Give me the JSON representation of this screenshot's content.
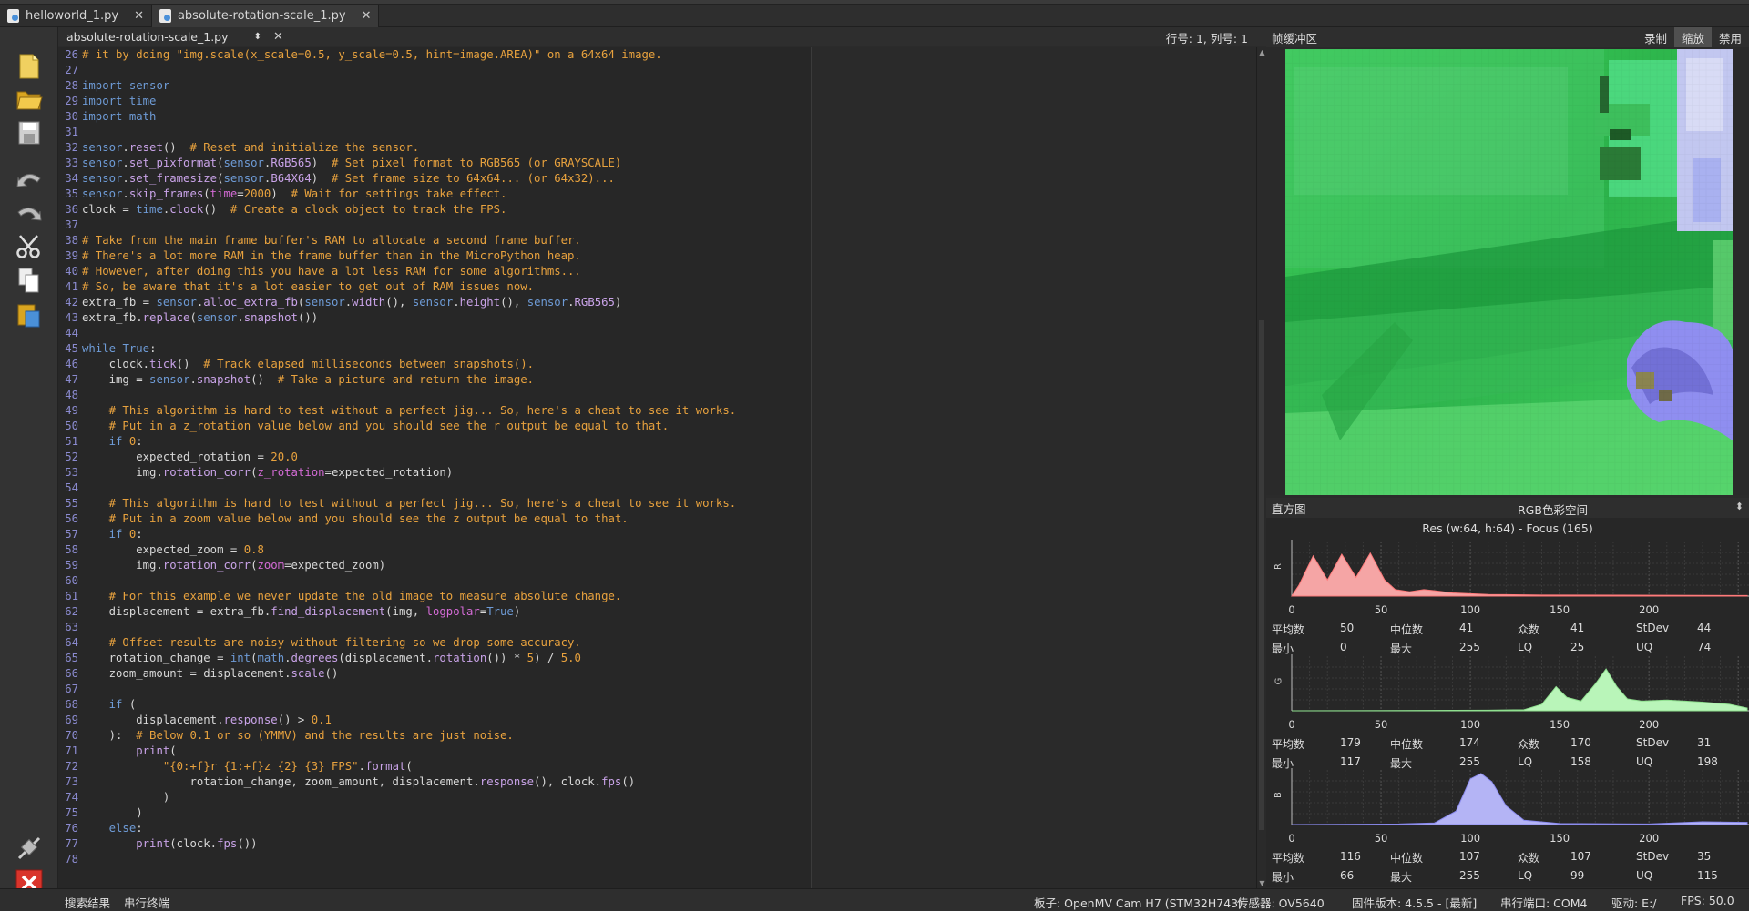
{
  "tabs": [
    {
      "label": "helloworld_1.py",
      "active": false
    },
    {
      "label": "absolute-rotation-scale_1.py",
      "active": true
    }
  ],
  "editor": {
    "file_selector": "absolute-rotation-scale_1.py",
    "cursor_pos": "行号: 1, 列号: 1",
    "lines": [
      {
        "n": "26",
        "h": [
          [
            "c-cm",
            "# it by doing \"img.scale(x_scale=0.5, y_scale=0.5, hint=image.AREA)\" on a 64x64 image."
          ]
        ]
      },
      {
        "n": "27",
        "h": []
      },
      {
        "n": "28",
        "h": [
          [
            "c-kw",
            "import"
          ],
          [
            "",
            "",
            " "
          ],
          [
            "c-mod",
            "sensor"
          ]
        ]
      },
      {
        "n": "29",
        "h": [
          [
            "c-kw",
            "import"
          ],
          [
            "",
            " "
          ],
          [
            "c-mod",
            "time"
          ]
        ]
      },
      {
        "n": "30",
        "h": [
          [
            "c-kw",
            "import"
          ],
          [
            "",
            " "
          ],
          [
            "c-mod",
            "math"
          ]
        ]
      },
      {
        "n": "31",
        "h": []
      },
      {
        "n": "32",
        "h": [
          [
            "c-mod",
            "sensor"
          ],
          [
            "",
            "."
          ],
          [
            "c-fn",
            "reset"
          ],
          [
            "",
            "()  "
          ],
          [
            "c-cm",
            "# Reset and initialize the sensor."
          ]
        ]
      },
      {
        "n": "33",
        "h": [
          [
            "c-mod",
            "sensor"
          ],
          [
            "",
            "."
          ],
          [
            "c-fn",
            "set_pixformat"
          ],
          [
            "",
            "("
          ],
          [
            "c-mod",
            "sensor"
          ],
          [
            "",
            "."
          ],
          [
            "c-fn",
            "RGB565"
          ],
          [
            "",
            ")  "
          ],
          [
            "c-cm",
            "# Set pixel format to RGB565 (or GRAYSCALE)"
          ]
        ]
      },
      {
        "n": "34",
        "h": [
          [
            "c-mod",
            "sensor"
          ],
          [
            "",
            "."
          ],
          [
            "c-fn",
            "set_framesize"
          ],
          [
            "",
            "("
          ],
          [
            "c-mod",
            "sensor"
          ],
          [
            "",
            "."
          ],
          [
            "c-fn",
            "B64X64"
          ],
          [
            "",
            ")  "
          ],
          [
            "c-cm",
            "# Set frame size to 64x64... (or 64x32)..."
          ]
        ]
      },
      {
        "n": "35",
        "h": [
          [
            "c-mod",
            "sensor"
          ],
          [
            "",
            "."
          ],
          [
            "c-fn",
            "skip_frames"
          ],
          [
            "",
            "("
          ],
          [
            "c-kwa",
            "time"
          ],
          [
            "",
            "="
          ],
          [
            "c-num",
            "2000"
          ],
          [
            "",
            ")  "
          ],
          [
            "c-cm",
            "# Wait for settings take effect."
          ]
        ]
      },
      {
        "n": "36",
        "h": [
          [
            "",
            "clock = "
          ],
          [
            "c-mod",
            "time"
          ],
          [
            "",
            "."
          ],
          [
            "c-fn",
            "clock"
          ],
          [
            "",
            "()  "
          ],
          [
            "c-cm",
            "# Create a clock object to track the FPS."
          ]
        ]
      },
      {
        "n": "37",
        "h": []
      },
      {
        "n": "38",
        "h": [
          [
            "c-cm",
            "# Take from the main frame buffer's RAM to allocate a second frame buffer."
          ]
        ]
      },
      {
        "n": "39",
        "h": [
          [
            "c-cm",
            "# There's a lot more RAM in the frame buffer than in the MicroPython heap."
          ]
        ]
      },
      {
        "n": "40",
        "h": [
          [
            "c-cm",
            "# However, after doing this you have a lot less RAM for some algorithms..."
          ]
        ]
      },
      {
        "n": "41",
        "h": [
          [
            "c-cm",
            "# So, be aware that it's a lot easier to get out of RAM issues now."
          ]
        ]
      },
      {
        "n": "42",
        "h": [
          [
            "",
            "extra_fb = "
          ],
          [
            "c-mod",
            "sensor"
          ],
          [
            "",
            "."
          ],
          [
            "c-fn",
            "alloc_extra_fb"
          ],
          [
            "",
            "("
          ],
          [
            "c-mod",
            "sensor"
          ],
          [
            "",
            "."
          ],
          [
            "c-fn",
            "width"
          ],
          [
            "",
            "(), "
          ],
          [
            "c-mod",
            "sensor"
          ],
          [
            "",
            "."
          ],
          [
            "c-fn",
            "height"
          ],
          [
            "",
            "(), "
          ],
          [
            "c-mod",
            "sensor"
          ],
          [
            "",
            "."
          ],
          [
            "c-fn",
            "RGB565"
          ],
          [
            "",
            ")"
          ]
        ]
      },
      {
        "n": "43",
        "h": [
          [
            "",
            "extra_fb."
          ],
          [
            "c-fn",
            "replace"
          ],
          [
            "",
            "("
          ],
          [
            "c-mod",
            "sensor"
          ],
          [
            "",
            "."
          ],
          [
            "c-fn",
            "snapshot"
          ],
          [
            "",
            "())"
          ]
        ]
      },
      {
        "n": "44",
        "h": []
      },
      {
        "n": "45",
        "h": [
          [
            "c-kw",
            "while"
          ],
          [
            "",
            " "
          ],
          [
            "c-kw",
            "True"
          ],
          [
            "",
            ":"
          ]
        ]
      },
      {
        "n": "46",
        "h": [
          [
            "",
            "    clock."
          ],
          [
            "c-fn",
            "tick"
          ],
          [
            "",
            "()  "
          ],
          [
            "c-cm",
            "# Track elapsed milliseconds between snapshots()."
          ]
        ]
      },
      {
        "n": "47",
        "h": [
          [
            "",
            "    img = "
          ],
          [
            "c-mod",
            "sensor"
          ],
          [
            "",
            "."
          ],
          [
            "c-fn",
            "snapshot"
          ],
          [
            "",
            "()  "
          ],
          [
            "c-cm",
            "# Take a picture and return the image."
          ]
        ]
      },
      {
        "n": "48",
        "h": []
      },
      {
        "n": "49",
        "h": [
          [
            "",
            "    "
          ],
          [
            "c-cm",
            "# This algorithm is hard to test without a perfect jig... So, here's a cheat to see it works."
          ]
        ]
      },
      {
        "n": "50",
        "h": [
          [
            "",
            "    "
          ],
          [
            "c-cm",
            "# Put in a z_rotation value below and you should see the r output be equal to that."
          ]
        ]
      },
      {
        "n": "51",
        "h": [
          [
            "",
            "    "
          ],
          [
            "c-kw",
            "if"
          ],
          [
            "",
            " "
          ],
          [
            "c-num",
            "0"
          ],
          [
            "",
            ":"
          ]
        ]
      },
      {
        "n": "52",
        "h": [
          [
            "",
            "        expected_rotation = "
          ],
          [
            "c-num",
            "20.0"
          ]
        ]
      },
      {
        "n": "53",
        "h": [
          [
            "",
            "        img."
          ],
          [
            "c-fn",
            "rotation_corr"
          ],
          [
            "",
            "("
          ],
          [
            "c-kwa",
            "z_rotation"
          ],
          [
            "",
            "=expected_rotation)"
          ]
        ]
      },
      {
        "n": "54",
        "h": []
      },
      {
        "n": "55",
        "h": [
          [
            "",
            "    "
          ],
          [
            "c-cm",
            "# This algorithm is hard to test without a perfect jig... So, here's a cheat to see it works."
          ]
        ]
      },
      {
        "n": "56",
        "h": [
          [
            "",
            "    "
          ],
          [
            "c-cm",
            "# Put in a zoom value below and you should see the z output be equal to that."
          ]
        ]
      },
      {
        "n": "57",
        "h": [
          [
            "",
            "    "
          ],
          [
            "c-kw",
            "if"
          ],
          [
            "",
            " "
          ],
          [
            "c-num",
            "0"
          ],
          [
            "",
            ":"
          ]
        ]
      },
      {
        "n": "58",
        "h": [
          [
            "",
            "        expected_zoom = "
          ],
          [
            "c-num",
            "0.8"
          ]
        ]
      },
      {
        "n": "59",
        "h": [
          [
            "",
            "        img."
          ],
          [
            "c-fn",
            "rotation_corr"
          ],
          [
            "",
            "("
          ],
          [
            "c-kwa",
            "zoom"
          ],
          [
            "",
            "=expected_zoom)"
          ]
        ]
      },
      {
        "n": "60",
        "h": []
      },
      {
        "n": "61",
        "h": [
          [
            "",
            "    "
          ],
          [
            "c-cm",
            "# For this example we never update the old image to measure absolute change."
          ]
        ]
      },
      {
        "n": "62",
        "h": [
          [
            "",
            "    displacement = extra_fb."
          ],
          [
            "c-fn",
            "find_displacement"
          ],
          [
            "",
            "(img, "
          ],
          [
            "c-kwa",
            "logpolar"
          ],
          [
            "",
            "="
          ],
          [
            "c-kw",
            "True"
          ],
          [
            "",
            ")"
          ]
        ]
      },
      {
        "n": "63",
        "h": []
      },
      {
        "n": "64",
        "h": [
          [
            "",
            "    "
          ],
          [
            "c-cm",
            "# Offset results are noisy without filtering so we drop some accuracy."
          ]
        ]
      },
      {
        "n": "65",
        "h": [
          [
            "",
            "    rotation_change = "
          ],
          [
            "c-kw",
            "int"
          ],
          [
            "",
            "("
          ],
          [
            "c-mod",
            "math"
          ],
          [
            "",
            "."
          ],
          [
            "c-fn",
            "degrees"
          ],
          [
            "",
            "(displacement."
          ],
          [
            "c-fn",
            "rotation"
          ],
          [
            "",
            "()) * "
          ],
          [
            "c-num",
            "5"
          ],
          [
            "",
            ") / "
          ],
          [
            "c-num",
            "5.0"
          ]
        ]
      },
      {
        "n": "66",
        "h": [
          [
            "",
            "    zoom_amount = displacement."
          ],
          [
            "c-fn",
            "scale"
          ],
          [
            "",
            "()"
          ]
        ]
      },
      {
        "n": "67",
        "h": []
      },
      {
        "n": "68",
        "h": [
          [
            "",
            "    "
          ],
          [
            "c-kw",
            "if"
          ],
          [
            "",
            " ("
          ]
        ]
      },
      {
        "n": "69",
        "h": [
          [
            "",
            "        displacement."
          ],
          [
            "c-fn",
            "response"
          ],
          [
            "",
            "() > "
          ],
          [
            "c-num",
            "0.1"
          ]
        ]
      },
      {
        "n": "70",
        "h": [
          [
            "",
            "    ):  "
          ],
          [
            "c-cm",
            "# Below 0.1 or so (YMMV) and the results are just noise."
          ]
        ]
      },
      {
        "n": "71",
        "h": [
          [
            "",
            "        "
          ],
          [
            "c-fn",
            "print"
          ],
          [
            "",
            "("
          ]
        ]
      },
      {
        "n": "72",
        "h": [
          [
            "",
            "            "
          ],
          [
            "c-str",
            "\"{0:+f}r {1:+f}z {2} {3} FPS\""
          ],
          [
            "",
            "."
          ],
          [
            "c-fn",
            "format"
          ],
          [
            "",
            "("
          ]
        ]
      },
      {
        "n": "73",
        "h": [
          [
            "",
            "                rotation_change, zoom_amount, displacement."
          ],
          [
            "c-fn",
            "response"
          ],
          [
            "",
            "(), clock."
          ],
          [
            "c-fn",
            "fps"
          ],
          [
            "",
            "()"
          ]
        ]
      },
      {
        "n": "74",
        "h": [
          [
            "",
            "            )"
          ]
        ]
      },
      {
        "n": "75",
        "h": [
          [
            "",
            "        )"
          ]
        ]
      },
      {
        "n": "76",
        "h": [
          [
            "",
            "    "
          ],
          [
            "c-kw",
            "else"
          ],
          [
            "",
            ":"
          ]
        ]
      },
      {
        "n": "77",
        "h": [
          [
            "",
            "        "
          ],
          [
            "c-fn",
            "print"
          ],
          [
            "",
            "(clock."
          ],
          [
            "c-fn",
            "fps"
          ],
          [
            "",
            "())"
          ]
        ]
      },
      {
        "n": "78",
        "h": []
      }
    ]
  },
  "framebuffer": {
    "title": "帧缓冲区",
    "buttons": [
      "录制",
      "缩放",
      "禁用"
    ],
    "active_button": "缩放"
  },
  "histogram": {
    "title": "直方图",
    "colorspace": "RGB色彩空间",
    "res": "Res (w:64, h:64) - Focus (165)",
    "axis_ticks": [
      "0",
      "50",
      "100",
      "150",
      "200"
    ],
    "stat_labels": {
      "mean": "平均数",
      "median": "中位数",
      "mode": "众数",
      "stdev": "StDev",
      "min": "最小",
      "max": "最大",
      "lq": "LQ",
      "uq": "UQ"
    },
    "channels": [
      {
        "name": "R",
        "color": "#f5a5a5",
        "stroke": "#ff7a7a",
        "stats": {
          "mean": "50",
          "median": "41",
          "mode": "41",
          "stdev": "44",
          "min": "0",
          "max": "255",
          "lq": "25",
          "uq": "74"
        }
      },
      {
        "name": "G",
        "color": "#b9f5b9",
        "stroke": "#8fe08f",
        "stats": {
          "mean": "179",
          "median": "174",
          "mode": "170",
          "stdev": "31",
          "min": "117",
          "max": "255",
          "lq": "158",
          "uq": "198"
        }
      },
      {
        "name": "B",
        "color": "#b4b4f5",
        "stroke": "#8a8aee",
        "stats": {
          "mean": "116",
          "median": "107",
          "mode": "107",
          "stdev": "35",
          "min": "66",
          "max": "255",
          "lq": "99",
          "uq": "115"
        }
      }
    ]
  },
  "statusbar": {
    "search": "搜索结果",
    "serial": "串行终端",
    "board": "板子: OpenMV Cam H7 (STM32H743)",
    "sensor": "传感器: OV5640",
    "firmware": "固件版本: 4.5.5 - [最新]",
    "port": "串行端口: COM4",
    "drive": "驱动: E:/",
    "fps": "FPS: 50.0"
  },
  "icons": [
    "new-file-icon",
    "open-folder-icon",
    "save-icon",
    "undo-icon",
    "redo-icon",
    "cut-icon",
    "copy-icon",
    "paste-icon",
    "connect-icon",
    "disconnect-icon"
  ]
}
